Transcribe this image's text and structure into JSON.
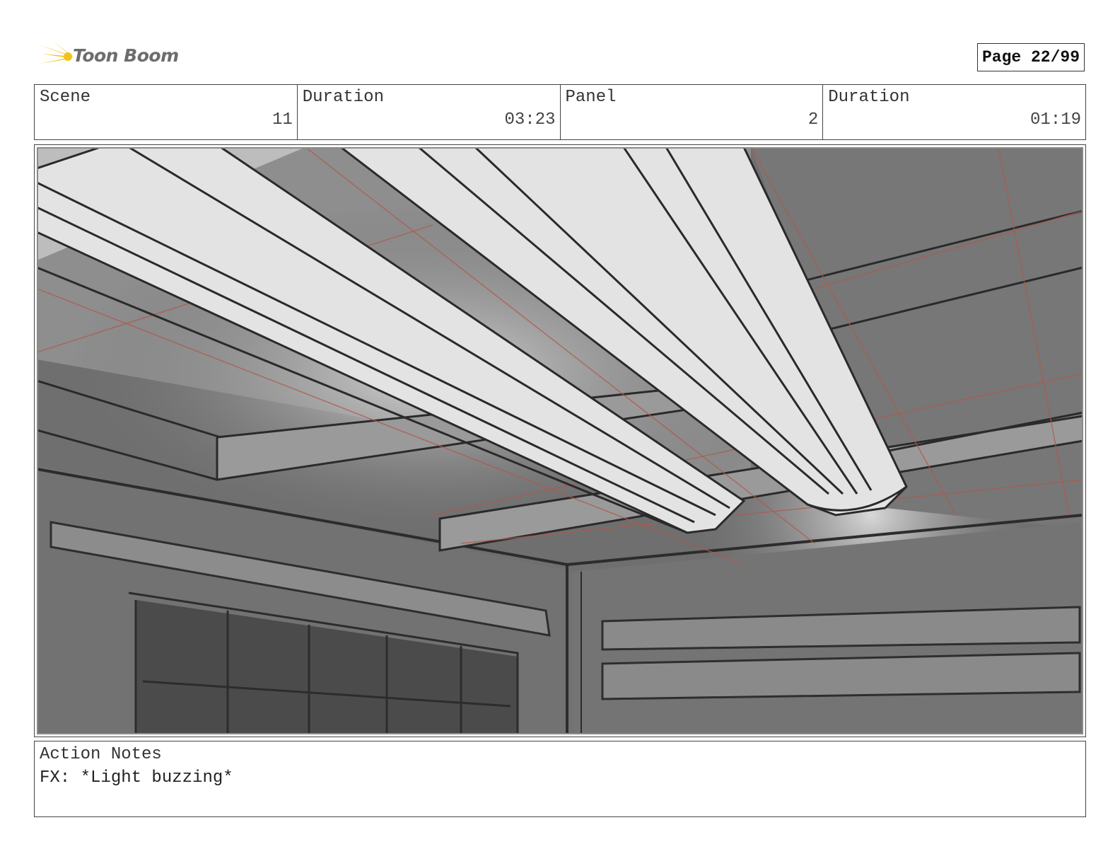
{
  "brand": {
    "name": "Toon Boom",
    "logo_icon": "toon-boom-star-icon",
    "accent": "#f2c21b"
  },
  "page": {
    "label": "Page 22/99"
  },
  "info": [
    {
      "label": "Scene",
      "value": "11"
    },
    {
      "label": "Duration",
      "value": "03:23"
    },
    {
      "label": "Panel",
      "value": "2"
    },
    {
      "label": "Duration",
      "value": "01:19"
    }
  ],
  "notes": {
    "label": "Action Notes",
    "text": "FX: *Light buzzing*"
  }
}
